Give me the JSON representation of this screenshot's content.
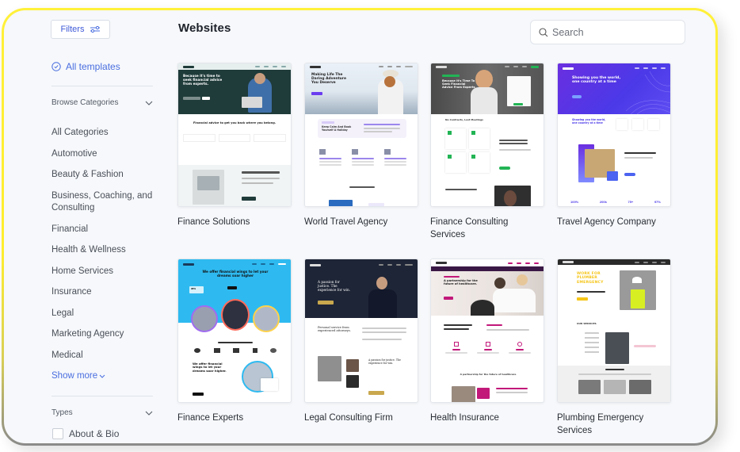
{
  "sidebar": {
    "filters_label": "Filters",
    "all_templates_label": "All templates",
    "browse_categories_label": "Browse Categories",
    "categories": [
      "All Categories",
      "Automotive",
      "Beauty & Fashion",
      "Business, Coaching, and Consulting",
      "Financial",
      "Health & Wellness",
      "Home Services",
      "Insurance",
      "Legal",
      "Marketing Agency",
      "Medical"
    ],
    "show_more_label": "Show more",
    "types_label": "Types",
    "types": [
      {
        "label": "About & Bio",
        "checked": false
      }
    ]
  },
  "main": {
    "title": "Websites",
    "search_placeholder": "Search",
    "templates": [
      {
        "title": "Finance Solutions",
        "hero_text": "Because it's time to seek financial advice from experts.",
        "section_text": "Financial advice to get you back where you belong.",
        "accent": "#1f3b3a"
      },
      {
        "title": "World Travel Agency",
        "hero_text": "Making Life The Daring Adventure You Deserve",
        "section_text": "Keep Calm And Book Yourself A Holiday",
        "accent": "#6a3cf0"
      },
      {
        "title": "Finance Consulting Services",
        "hero_text": "Because It's Time To Seek Financial Advice From Experts",
        "section_text": "No Contracts, Lost Meetings",
        "accent": "#22b455"
      },
      {
        "title": "Travel Agency Company",
        "hero_text": "Showing you the world, one country at a time",
        "section_text": "Showing you the world, one country at a time",
        "stats": [
          "100%",
          "200k",
          "75+",
          "97%"
        ],
        "accent": "#5b2ee0"
      },
      {
        "title": "Finance Experts",
        "hero_text": "We offer financial wings to let your dreams soar higher",
        "section_text": "We offer financial wings to let your dreams soar higher.",
        "badge": "98%",
        "accent": "#2ebaf0"
      },
      {
        "title": "Legal Consulting Firm",
        "hero_text": "A passion for justice. The experience for win.",
        "section_text": "Personal service from experienced attorneys.",
        "accent": "#1e2536"
      },
      {
        "title": "Health Insurance",
        "hero_text": "A partnership for the future of healthcare.",
        "section_text": "A partnership for the future of healthcare",
        "accent": "#c2187a"
      },
      {
        "title": "Plumbing Emergency Services",
        "hero_text": "WORK FOR PLUMBER EMERGENCY",
        "section_text": "OUR SERVICES",
        "accent": "#f5c518"
      }
    ]
  },
  "colors": {
    "link_blue": "#4a6ee0",
    "frame_yellow": "#fff03a",
    "background": "#f6f8fb"
  }
}
